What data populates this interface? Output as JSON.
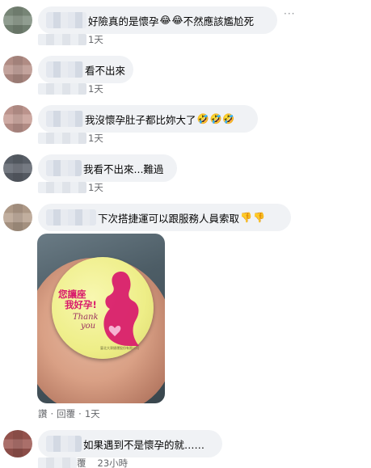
{
  "comments": [
    {
      "text": "好險真的是懷孕",
      "emojis": [
        "😂",
        "😂"
      ],
      "text_after": "不然應該尷尬死",
      "action": "1天",
      "more_label": "···"
    },
    {
      "text": "看不出來",
      "emojis": [],
      "text_after": "",
      "action": "1天"
    },
    {
      "text": "我沒懷孕肚子都比妳大了",
      "emojis": [
        "🤣",
        "🤣",
        "🤣"
      ],
      "text_after": "",
      "action": "1天"
    },
    {
      "text": "我看不出來...難過",
      "emojis": [],
      "text_after": "",
      "action": "1天"
    },
    {
      "text": "下次搭捷運可以跟服務人員索取",
      "emojis": [
        "👎",
        "👎"
      ],
      "text_after": "",
      "photo": {
        "badge_line1": "您讓座",
        "badge_line2": "我好孕!",
        "badge_line3": "Thank",
        "badge_line4": "you",
        "badge_small": "臺北大眾捷運股份有限公司"
      },
      "action_like": "讚",
      "action_reply": "回覆",
      "action_dot": "·",
      "action": "1天"
    },
    {
      "text": "如果遇到不是懷孕的就……",
      "emojis": [],
      "text_after": "",
      "action_reply_partial": "覆",
      "action": "23小時"
    }
  ],
  "colors": {
    "bubble": "#f0f2f5",
    "text": "#050505",
    "meta": "#65676b",
    "badge_text": "#d8186b"
  }
}
